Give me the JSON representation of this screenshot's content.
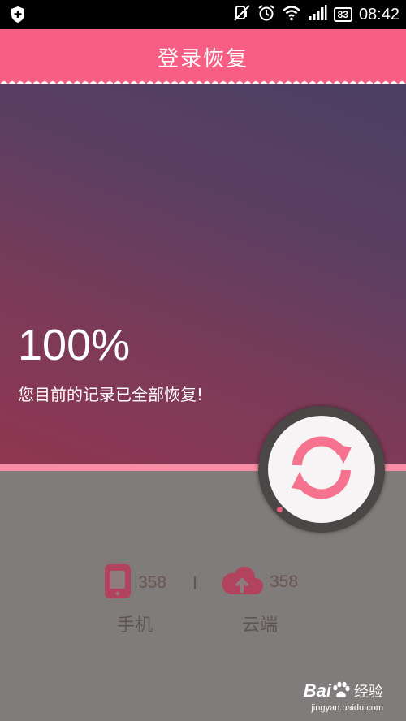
{
  "status_bar": {
    "time": "08:42",
    "battery": "83",
    "icons": [
      "shield-icon",
      "mute-icon",
      "alarm-icon",
      "wifi-icon",
      "signal-icon",
      "battery-icon"
    ]
  },
  "header": {
    "title": "登录恢复"
  },
  "hero": {
    "percent_text": "100%",
    "progress_value": 1.0,
    "message": "您目前的记录已全部恢复!"
  },
  "sync_button": {
    "icon": "sync-icon"
  },
  "stats": {
    "phone": {
      "count": "358",
      "label": "手机",
      "icon": "phone-icon"
    },
    "cloud": {
      "count": "358",
      "label": "云端",
      "icon": "cloud-upload-icon"
    }
  },
  "watermark": {
    "brand_part1": "Bai",
    "brand_part2": "经验",
    "url": "jingyan.baidu.com"
  },
  "colors": {
    "accent": "#f65f83",
    "progress": "#f88ea5",
    "bottom_bg": "#807c7b"
  }
}
